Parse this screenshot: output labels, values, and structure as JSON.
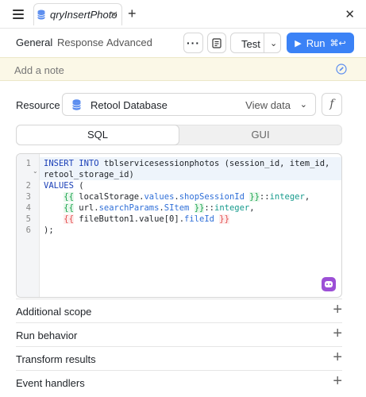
{
  "tab": {
    "name": "qryInsertPhoto",
    "close": "✕"
  },
  "toolbar": {
    "tabs": [
      "General",
      "Response",
      "Advanced"
    ],
    "more": "···",
    "test_label": "Test",
    "run_label": "Run",
    "run_shortcut": "⌘↩"
  },
  "note": {
    "placeholder": "Add a note"
  },
  "resource": {
    "label": "Resource",
    "name": "Retool Database",
    "view_data": "View data",
    "fx": "f"
  },
  "mode": {
    "options": [
      "SQL",
      "GUI"
    ],
    "selected": "SQL"
  },
  "editor": {
    "line_numbers": [
      "1",
      "2",
      "3",
      "4",
      "5",
      "6"
    ],
    "lines": [
      "INSERT INTO tblservicesessionphotos (session_id, item_id,",
      "retool_storage_id)",
      "VALUES (",
      "    {{ localStorage.values.shopSessionId }}::integer,",
      "    {{ url.searchParams.SItem }}::integer,",
      "    {{ fileButton1.value[0].fileId }}",
      ");"
    ]
  },
  "sections": [
    "Additional scope",
    "Run behavior",
    "Transform results",
    "Event handlers"
  ],
  "colors": {
    "accent": "#3b82f6",
    "note_bg": "#fbf8e7",
    "assist": "#9c4fd6"
  }
}
